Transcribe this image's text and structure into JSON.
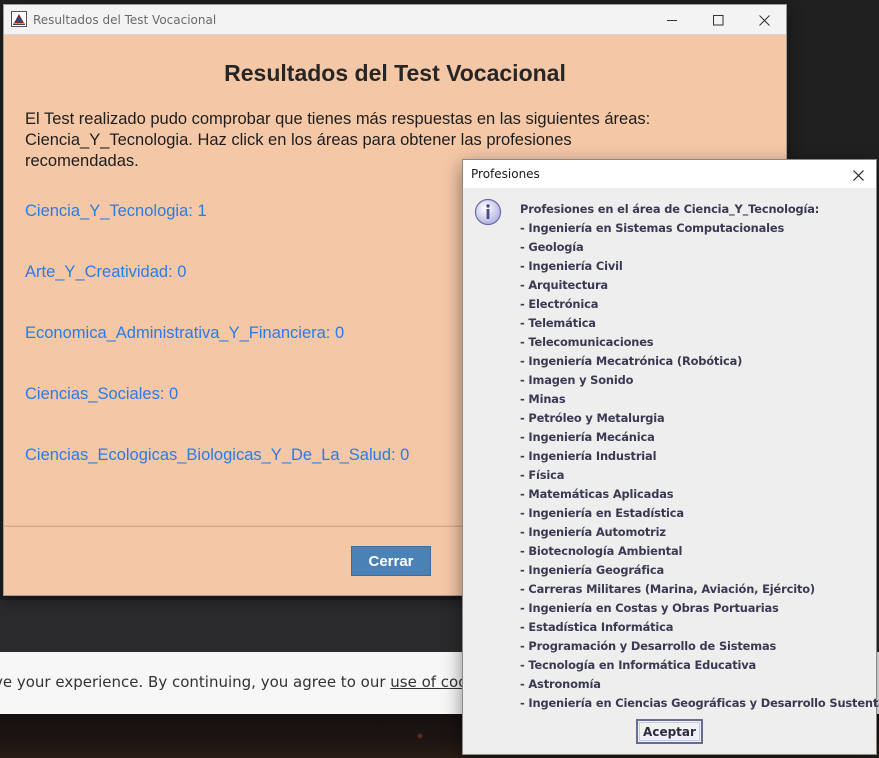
{
  "main_window": {
    "title": "Resultados del Test Vocacional",
    "heading": "Resultados del Test Vocacional",
    "intro_text": "El Test realizado pudo comprobar que tienes más respuestas en las siguientes áreas: Ciencia_Y_Tecnologia. Haz click en los áreas para obtener las profesiones recomendadas.",
    "areas": [
      "Ciencia_Y_Tecnologia: 1",
      "Arte_Y_Creatividad: 0",
      "Economica_Administrativa_Y_Financiera: 0",
      "Ciencias_Sociales: 0",
      "Ciencias_Ecologicas_Biologicas_Y_De_La_Salud: 0"
    ],
    "close_button_label": "Cerrar"
  },
  "dialog": {
    "title": "Profesiones",
    "heading": "Profesiones en el área de Ciencia_Y_Tecnología:",
    "professions": [
      "- Ingeniería en Sistemas Computacionales",
      "- Geología",
      "- Ingeniería Civil",
      "- Arquitectura",
      "- Electrónica",
      "- Telemática",
      "- Telecomunicaciones",
      "- Ingeniería Mecatrónica (Robótica)",
      "- Imagen y Sonido",
      "- Minas",
      "- Petróleo y Metalurgia",
      "- Ingeniería Mecánica",
      "- Ingeniería Industrial",
      "- Física",
      "- Matemáticas Aplicadas",
      "- Ingeniería en Estadística",
      "- Ingeniería Automotriz",
      "- Biotecnología Ambiental",
      "- Ingeniería Geográfica",
      "- Carreras Militares (Marina,  Aviación,  Ejército)",
      "- Ingeniería en Costas y Obras Portuarias",
      "- Estadística Informática",
      "- Programación y Desarrollo de Sistemas",
      "- Tecnología en Informática Educativa",
      "- Astronomía",
      "- Ingeniería en Ciencias Geográficas y Desarrollo Sustentable"
    ],
    "accept_button_label": "Aceptar"
  },
  "background": {
    "cookie_text": "ve your experience. By continuing, you agree to our ",
    "cookie_link": "use of cookies"
  },
  "icons": {
    "app": "java-app-icon",
    "minimize": "minimize-icon",
    "maximize": "maximize-icon",
    "close": "close-icon",
    "info": "info-icon"
  },
  "colors": {
    "window_background": "#f4c7a7",
    "link": "#2c7be5",
    "primary_button": "#4a82b8"
  }
}
